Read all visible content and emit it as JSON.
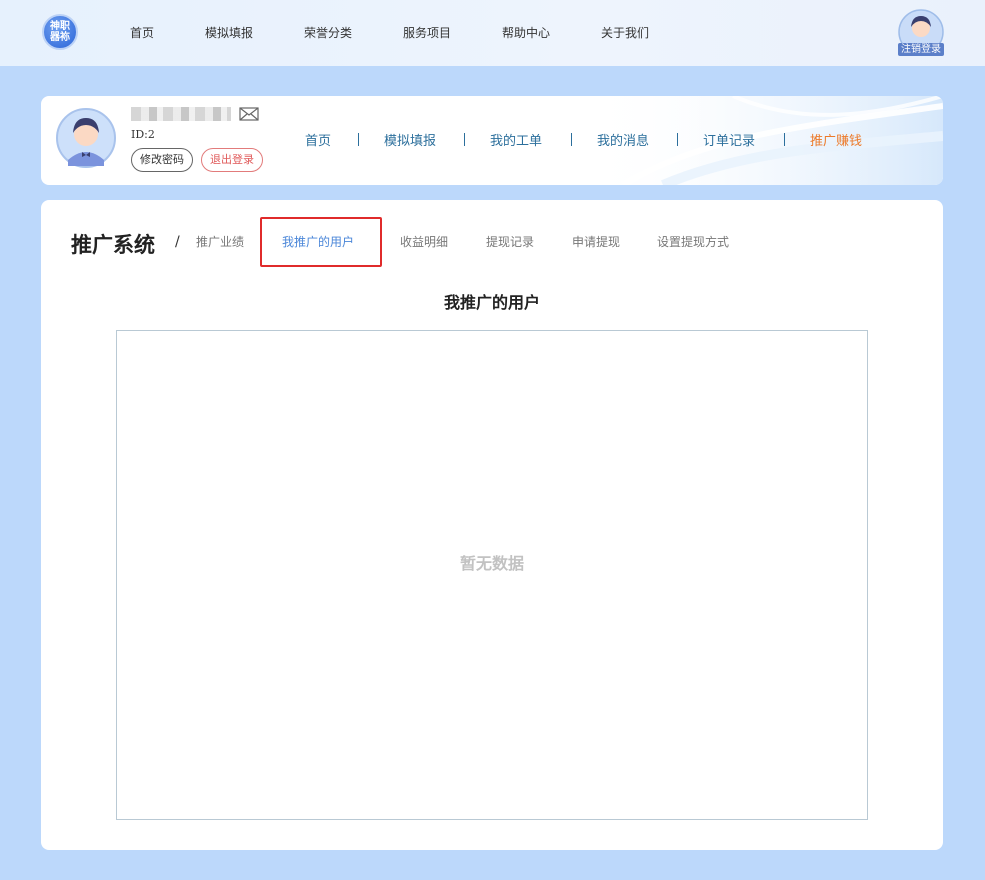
{
  "brand": {
    "logo_text": "神职器袮"
  },
  "top_nav": [
    {
      "label": "首页"
    },
    {
      "label": "模拟填报"
    },
    {
      "label": "荣誉分类"
    },
    {
      "label": "服务项目"
    },
    {
      "label": "帮助中心"
    },
    {
      "label": "关于我们"
    }
  ],
  "top_user": {
    "badge": "注销登录"
  },
  "profile": {
    "user_id": "ID:2",
    "change_password": "修改密码",
    "logout": "退出登录"
  },
  "sub_nav": [
    {
      "label": "首页",
      "active": false
    },
    {
      "label": "模拟填报",
      "active": false
    },
    {
      "label": "我的工单",
      "active": false
    },
    {
      "label": "我的消息",
      "active": false
    },
    {
      "label": "订单记录",
      "active": false
    },
    {
      "label": "推广赚钱",
      "active": true
    }
  ],
  "promo": {
    "title": "推广系统",
    "separator": "/",
    "tabs": [
      {
        "label": "推广业绩",
        "active": false
      },
      {
        "label": "我推广的用户",
        "active": true
      },
      {
        "label": "收益明细",
        "active": false
      },
      {
        "label": "提现记录",
        "active": false
      },
      {
        "label": "申请提现",
        "active": false
      },
      {
        "label": "设置提现方式",
        "active": false
      }
    ],
    "section_title": "我推广的用户",
    "empty_text": "暂无数据"
  },
  "colors": {
    "page_bg": "#bcd8fb",
    "accent_active": "#ec7a2a",
    "link": "#2c6f9c",
    "tab_active": "#4a86d8",
    "highlight": "#e02b2b"
  },
  "icons": [
    "mail-icon",
    "avatar-icon",
    "logo-icon"
  ]
}
